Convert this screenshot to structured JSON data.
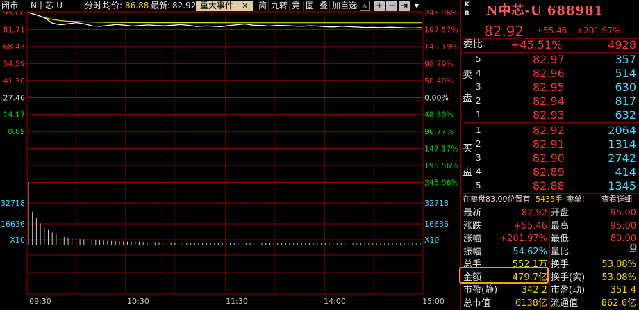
{
  "chart_topbar": {
    "status": "闭市",
    "stock": "N中芯-U",
    "mode": "分时",
    "avg_label": "均价:",
    "avg_value": "86.88",
    "latest_label": "最新:",
    "latest_value": "82.92",
    "event_button": "重大事件",
    "event_close": "×",
    "tabs": [
      "简",
      "九转",
      "竞",
      "固",
      "叠",
      "加自选"
    ],
    "ctrl": [
      "+",
      "−",
      "⇥",
      "▾"
    ]
  },
  "chart_data": {
    "type": "line",
    "price_axis_left": [
      "95.00",
      "81.71",
      "68.43",
      "54.59",
      "41.30",
      "27.46",
      "14.17",
      "0.89"
    ],
    "pct_axis_right": [
      "245.96%",
      "197.57%",
      "149.19%",
      "98.79%",
      "50.40%",
      "0.00%",
      "48.39%",
      "96.77%",
      "147.17%",
      "195.56%",
      "245.96%"
    ],
    "pct_axis_colors": [
      "red",
      "red",
      "red",
      "red",
      "red",
      "white",
      "green",
      "green",
      "green",
      "green",
      "green"
    ],
    "volume_axis": [
      "32718",
      "16636",
      "X10"
    ],
    "x_labels": [
      "09:30",
      "10:30",
      "11:30",
      "14:00",
      "15:00"
    ],
    "price_range": [
      -27.46,
      95.0
    ],
    "prev_close": 27.46,
    "price_series": [
      95.0,
      93.1,
      90.8,
      86.5,
      85.2,
      86.1,
      87.0,
      85.9,
      84.3,
      84.0,
      84.8,
      85.5,
      84.9,
      84.2,
      84.7,
      85.1,
      84.6,
      84.4,
      84.9,
      85.4,
      84.8,
      83.9,
      84.3,
      84.1,
      83.8,
      84.6,
      85.3,
      85.9,
      84.9,
      84.7,
      84.2,
      84.8,
      84.6,
      84.3,
      84.0,
      84.4,
      84.2,
      83.7,
      83.5,
      84.1,
      83.8,
      83.4,
      83.0,
      83.2,
      82.9,
      83.3,
      83.0,
      82.8,
      82.6,
      82.92
    ],
    "avg_series": [
      95.0,
      93.0,
      91.0,
      89.5,
      88.6,
      88.1,
      87.8,
      87.6,
      87.4,
      87.3,
      87.2,
      87.15,
      87.1,
      87.05,
      87.0,
      86.98,
      86.96,
      86.95,
      86.94,
      86.93,
      86.92,
      86.92,
      86.91,
      86.91,
      86.9,
      86.9,
      86.9,
      86.9,
      86.9,
      86.89,
      86.89,
      86.89,
      86.89,
      86.89,
      86.89,
      86.89,
      86.88,
      86.88,
      86.88,
      86.88,
      86.88,
      86.88,
      86.88,
      86.88,
      86.88,
      86.88,
      86.88,
      86.88,
      86.88,
      86.88
    ],
    "volume_series": [
      49000,
      26000,
      21000,
      17000,
      14000,
      12000,
      10000,
      8500,
      7200,
      6500,
      6000,
      5600,
      5200,
      4800,
      4600,
      4300,
      4100,
      3900,
      3700,
      3600,
      3500,
      3400,
      3300,
      3200,
      3100,
      3000,
      2900,
      2850,
      2800,
      2700,
      2650,
      2600,
      2550,
      2500,
      2450,
      2400,
      2350,
      2300,
      2250,
      2200,
      2150,
      2100,
      2100,
      2050,
      2000,
      2000,
      1950,
      1950,
      1900,
      1900,
      1850,
      1850,
      1800,
      1800,
      1800,
      1750,
      1750,
      1700,
      1700,
      1700,
      1650,
      1650,
      1650,
      1600,
      1600,
      1600,
      1600,
      1550,
      1550,
      1550,
      1550,
      1500,
      1500,
      1500,
      1500,
      1500,
      1450,
      1450,
      1450,
      1450,
      1450,
      1400,
      1400,
      1400,
      1400,
      1400,
      1400,
      1400,
      1350,
      1350,
      1350,
      1350,
      1350,
      1350,
      1350,
      1300,
      1300,
      1300,
      1300,
      1300
    ],
    "colors": {
      "price": "#ffffff",
      "avg": "#f2d300",
      "grid": "#8a0000",
      "volume": "#d0d0d0"
    }
  },
  "panel": {
    "kr": [
      "K",
      "R"
    ],
    "title": "N中芯-U 688981",
    "price": "82.92",
    "change": "+55.46",
    "change_pct": "+201.97%",
    "weibi": {
      "label": "委比",
      "pct": "+45.51%",
      "diff": "4928"
    },
    "sell_side": [
      "卖",
      "盘"
    ],
    "buy_side": [
      "买",
      "盘"
    ],
    "sell": [
      {
        "level": "5",
        "price": "82.97",
        "vol": "357"
      },
      {
        "level": "4",
        "price": "82.96",
        "vol": "514"
      },
      {
        "level": "3",
        "price": "82.95",
        "vol": "630"
      },
      {
        "level": "2",
        "price": "82.94",
        "vol": "817"
      },
      {
        "level": "1",
        "price": "82.93",
        "vol": "632"
      }
    ],
    "buy": [
      {
        "level": "1",
        "price": "82.92",
        "vol": "2064"
      },
      {
        "level": "2",
        "price": "82.91",
        "vol": "1314"
      },
      {
        "level": "3",
        "price": "82.90",
        "vol": "2742"
      },
      {
        "level": "4",
        "price": "82.89",
        "vol": "414"
      },
      {
        "level": "5",
        "price": "82.88",
        "vol": "1345"
      }
    ],
    "sell_info": {
      "prefix": "在卖盘83.00位置有",
      "qty": "5435手",
      "word": "卖单!",
      "link": "查看详细"
    },
    "stats_left": [
      {
        "label": "最新",
        "value": "82.92"
      },
      {
        "label": "涨跌",
        "value": "+55.46"
      },
      {
        "label": "涨幅",
        "value": "+201.97%"
      },
      {
        "label": "振幅",
        "value": "54.62%"
      },
      {
        "label": "总手",
        "value": "552.1万"
      },
      {
        "label": "金额",
        "value": "479.7亿"
      },
      {
        "label": "市盈(静)",
        "value": "342.2"
      },
      {
        "label": "总市值",
        "value": "6138亿"
      }
    ],
    "stats_right": [
      {
        "label": "开盘",
        "value": "95.00"
      },
      {
        "label": "最高",
        "value": "95.00"
      },
      {
        "label": "最低",
        "value": "80.00"
      },
      {
        "label": "量比",
        "value": "−"
      },
      {
        "label": "换手",
        "value": "53.08%"
      },
      {
        "label": "换手(实)",
        "value": "53.08%"
      },
      {
        "label": "市盈(动)",
        "value": "351.4"
      },
      {
        "label": "流通值",
        "value": "862.6亿"
      }
    ],
    "icons": [
      "settings-gear-icon"
    ]
  }
}
